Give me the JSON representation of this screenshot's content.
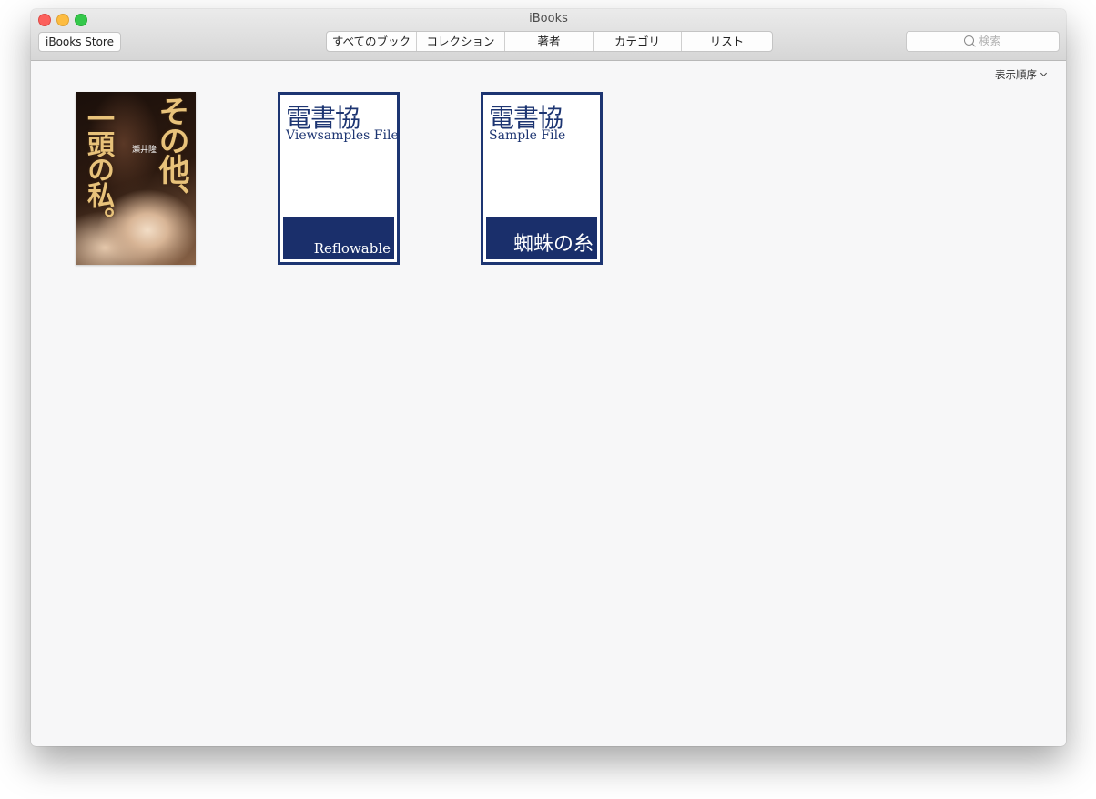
{
  "window": {
    "title": "iBooks"
  },
  "toolbar": {
    "store_label": "iBooks Store",
    "segments": [
      {
        "label": "すべてのブック"
      },
      {
        "label": "コレクション"
      },
      {
        "label": "著者"
      },
      {
        "label": "カテゴリ"
      },
      {
        "label": "リスト"
      }
    ],
    "search_placeholder": "検索"
  },
  "library": {
    "sort_label": "表示順序",
    "books": [
      {
        "title_line1": "その他、",
        "title_line2": "一頭の私。",
        "author": "瀬井隆"
      },
      {
        "brand": "電書協",
        "subtitle": "Viewsamples File",
        "label": "Reflowable"
      },
      {
        "brand": "電書協",
        "subtitle": "Sample File",
        "label": "蜘蛛の糸"
      }
    ]
  },
  "colors": {
    "close": "#fc605c",
    "minimize": "#fdbc40",
    "zoom": "#34c84a",
    "cover_navy": "#1d3572"
  },
  "icons": [
    "close-icon",
    "minimize-icon",
    "zoom-icon",
    "search-icon",
    "chevron-down-icon"
  ]
}
